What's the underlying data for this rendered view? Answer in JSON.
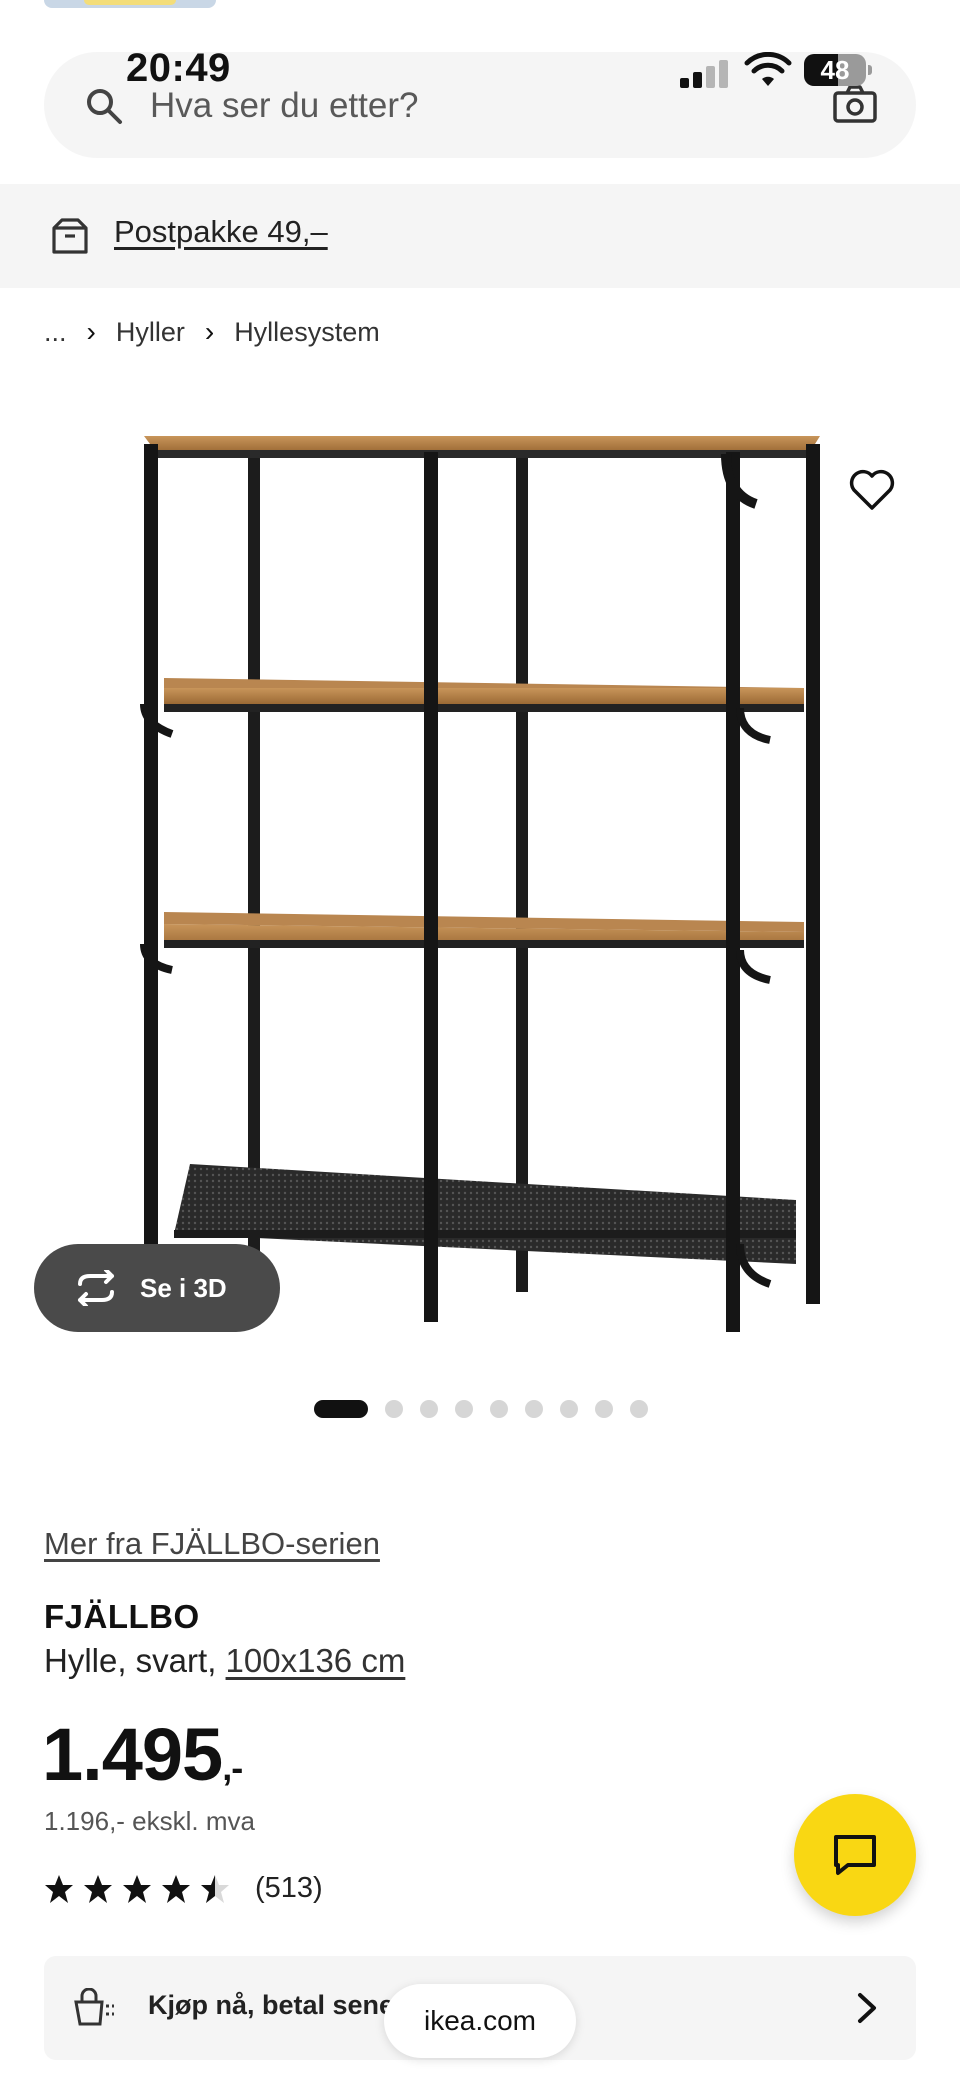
{
  "status_bar": {
    "time": "20:49",
    "battery": "48"
  },
  "search": {
    "placeholder": "Hva ser du etter?",
    "icon": "search-icon",
    "camera_icon": "camera-icon"
  },
  "delivery": {
    "label": "Postpakke 49,–",
    "icon": "box-icon"
  },
  "breadcrumb": {
    "items": [
      "...",
      "Hyller",
      "Hyllesystem"
    ],
    "separator": "›"
  },
  "gallery": {
    "view_3d_label": "Se i 3D",
    "dot_count": 9,
    "active_index": 0
  },
  "product": {
    "series_link": "Mer fra FJÄLLBO-serien",
    "name": "FJÄLLBO",
    "type": "Hylle, svart, ",
    "dimension": "100x136 cm",
    "price_main": "1.495",
    "price_suffix": ",-",
    "price_ex_vat": "1.196,- ekskl. mva",
    "rating_value": 4.5,
    "rating_max": 5,
    "review_count": "(513)"
  },
  "payment_banner": {
    "label": "Kjøp nå, betal senere"
  },
  "browser": {
    "url": "ikea.com"
  },
  "colors": {
    "accent_yellow": "#f9d713",
    "pill_dark": "#4a4a4a",
    "light_bg": "#f5f5f5"
  }
}
